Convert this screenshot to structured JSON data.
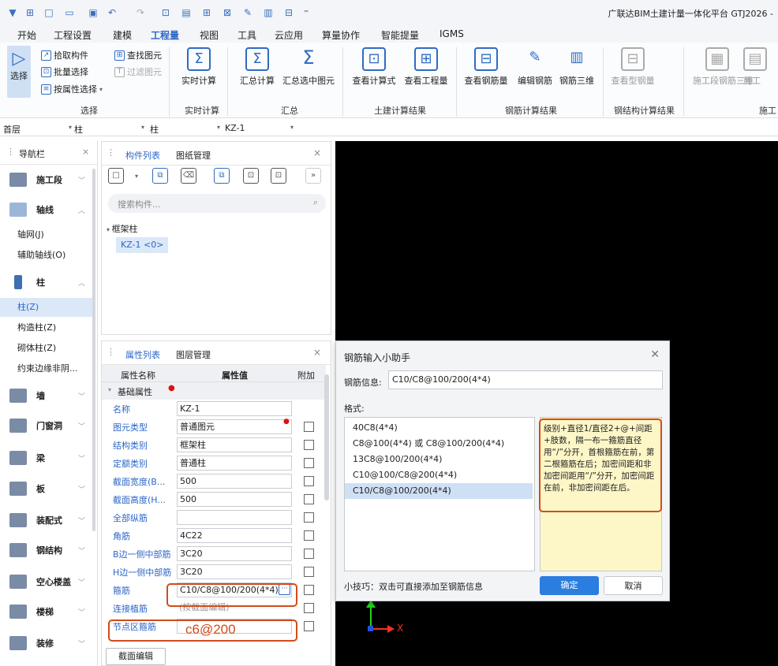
{
  "titlebar": {
    "app_title": "广联达BIM土建计量一体化平台 GTJ2026 -"
  },
  "menu": {
    "items": [
      "开始",
      "工程设置",
      "建模",
      "工程量",
      "视图",
      "工具",
      "云应用",
      "算量协作",
      "智能提量",
      "IGMS"
    ],
    "active": "工程量"
  },
  "ribbon": {
    "select_group": {
      "label": "选择",
      "select_btn": "选择",
      "pick_component": "拾取构件",
      "batch_select": "批量选择",
      "by_property": "按属性选择",
      "find_element": "查找图元",
      "filter_element": "过滤图元"
    },
    "realtime_group": {
      "label": "实时计算",
      "btn": "实时计算"
    },
    "summary_group": {
      "label": "汇总",
      "sum_calc": "汇总计算",
      "sum_selected": "汇总选中图元"
    },
    "civil_group": {
      "label": "土建计算结果",
      "view_formula": "查看计算式",
      "view_quantity": "查看工程量"
    },
    "rebar_group": {
      "label": "钢筋计算结果",
      "view_rebar": "查看钢筋量",
      "edit_rebar": "编辑钢筋",
      "rebar_3d": "钢筋三维"
    },
    "steel_group": {
      "label": "钢结构计算结果",
      "view_steel": "查看型钢量"
    },
    "construction_group": {
      "label": "施工",
      "seg_rebar_3d": "施工段钢筋三维",
      "seg_more": "施工"
    }
  },
  "selector_bar": {
    "floor": "首层",
    "type1": "柱",
    "type2": "柱",
    "component": "KZ-1"
  },
  "nav": {
    "title": "导航栏",
    "categories": [
      {
        "label": "施工段",
        "expanded": false
      },
      {
        "label": "轴线",
        "expanded": true
      },
      {
        "label": "柱",
        "expanded": true
      },
      {
        "label": "墙",
        "expanded": false
      },
      {
        "label": "门窗洞",
        "expanded": false
      },
      {
        "label": "梁",
        "expanded": false
      },
      {
        "label": "板",
        "expanded": false
      },
      {
        "label": "装配式",
        "expanded": false
      },
      {
        "label": "钢结构",
        "expanded": false
      },
      {
        "label": "空心楼盖",
        "expanded": false
      },
      {
        "label": "楼梯",
        "expanded": false
      },
      {
        "label": "装修",
        "expanded": false
      }
    ],
    "axis_items": [
      "轴网(J)",
      "辅助轴线(O)"
    ],
    "column_items": [
      "柱(Z)",
      "构造柱(Z)",
      "砌体柱(Z)",
      "约束边缘非阴..."
    ],
    "selected": "柱(Z)"
  },
  "component_panel": {
    "tabs": [
      "构件列表",
      "图纸管理"
    ],
    "active_tab": "构件列表",
    "search_placeholder": "搜索构件...",
    "tree_group": "框架柱",
    "tree_item": "KZ-1 <0>"
  },
  "property_panel": {
    "tabs": [
      "属性列表",
      "图层管理"
    ],
    "active_tab": "属性列表",
    "headers": {
      "name": "属性名称",
      "value": "属性值",
      "extra": "附加"
    },
    "section": "基础属性",
    "rows": [
      {
        "name": "名称",
        "value": "KZ-1",
        "has_check": false
      },
      {
        "name": "图元类型",
        "value": "普通图元",
        "has_check": true
      },
      {
        "name": "结构类别",
        "value": "框架柱",
        "has_check": true
      },
      {
        "name": "定额类别",
        "value": "普通柱",
        "has_check": true
      },
      {
        "name": "截面宽度(B...",
        "value": "500",
        "has_check": true
      },
      {
        "name": "截面高度(H...",
        "value": "500",
        "has_check": true
      },
      {
        "name": "全部纵筋",
        "value": "",
        "has_check": true
      },
      {
        "name": "角筋",
        "value": "4C22",
        "has_check": true
      },
      {
        "name": "B边一侧中部筋",
        "value": "3C20",
        "has_check": true
      },
      {
        "name": "H边一侧中部筋",
        "value": "3C20",
        "has_check": true
      },
      {
        "name": "箍筋",
        "value": "C10/C8@100/200(4*4)",
        "has_check": true
      },
      {
        "name": "连接植筋",
        "value": "(按截面编辑)",
        "has_check": true
      },
      {
        "name": "节点区箍筋",
        "value": "",
        "has_check": true
      }
    ],
    "node_annotation": "c6@200",
    "section_edit_btn": "截面编辑"
  },
  "dialog": {
    "title": "钢筋输入小助手",
    "info_label": "钢筋信息:",
    "info_value": "C10/C8@100/200(4*4)",
    "format_label": "格式:",
    "formats": [
      "40C8(4*4)",
      "C8@100(4*4) 或 C8@100/200(4*4)",
      "13C8@100/200(4*4)",
      "C10@100/C8@200(4*4)",
      "C10/C8@100/200(4*4)"
    ],
    "selected_format": "C10/C8@100/200(4*4)",
    "help_text": "级别+直径1/直径2+@+间距+肢数，隔一布一箍筋直径用“/”分开，首根箍筋在前，第二根箍筋在后；加密间距和非加密间距用“/”分开，加密间距在前，非加密间距在后。",
    "tip": "小技巧：双击可直接添加至钢筋信息",
    "ok_label": "确定",
    "cancel_label": "取消"
  },
  "canvas": {
    "axis_x": "X"
  },
  "colors": {
    "accent": "#2b66c8",
    "highlight_box": "#d14c1b",
    "help_bg": "#fdf7c8",
    "canvas_bg": "#000000"
  }
}
